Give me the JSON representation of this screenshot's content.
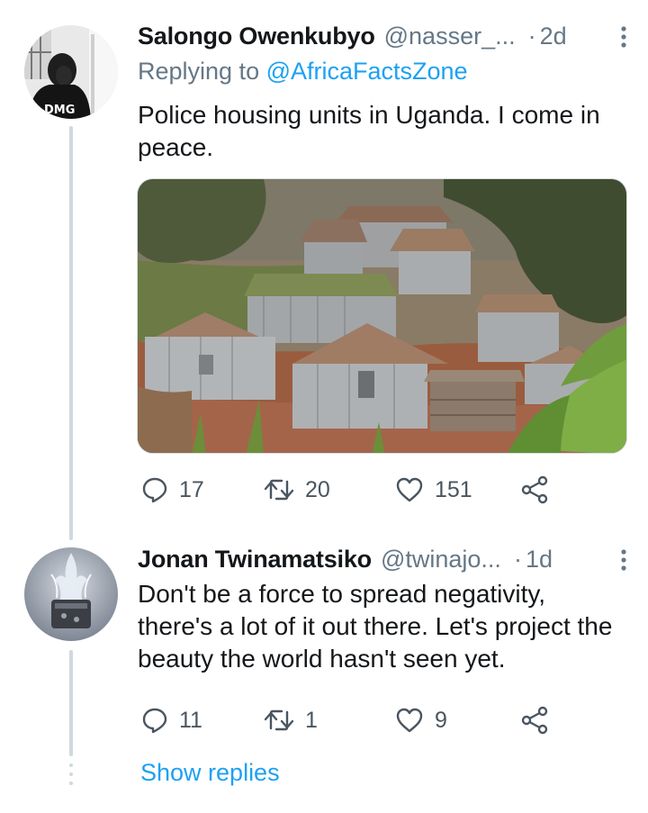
{
  "tweets": [
    {
      "display_name": "Salongo Owenkubyo",
      "handle": "@nasser_...",
      "separator": "·",
      "time": "2d",
      "reply_prefix": "Replying to ",
      "reply_to": "@AfricaFactsZone",
      "text": "Police housing units in Uganda. I come in peace.",
      "replies": "17",
      "retweets": "20",
      "likes": "151"
    },
    {
      "display_name": "Jonan Twinamatsiko",
      "handle": "@twinajo...",
      "separator": "·",
      "time": "1d",
      "text": "Don't be a force to spread negativity, there's a lot of it out there. Let's project the beauty the world hasn't seen yet.",
      "replies": "11",
      "retweets": "1",
      "likes": "9"
    }
  ],
  "show_replies": "Show replies",
  "avatar_logo_text": "DMG",
  "icons": {
    "reply": "speech-bubble-icon",
    "retweet": "retweet-icon",
    "like": "heart-icon",
    "share": "share-icon",
    "more": "more-vertical-icon"
  },
  "colors": {
    "accent": "#1da1f2",
    "secondary_text": "#657786",
    "primary_text": "#14171a",
    "thread_line": "#cfd9de"
  }
}
